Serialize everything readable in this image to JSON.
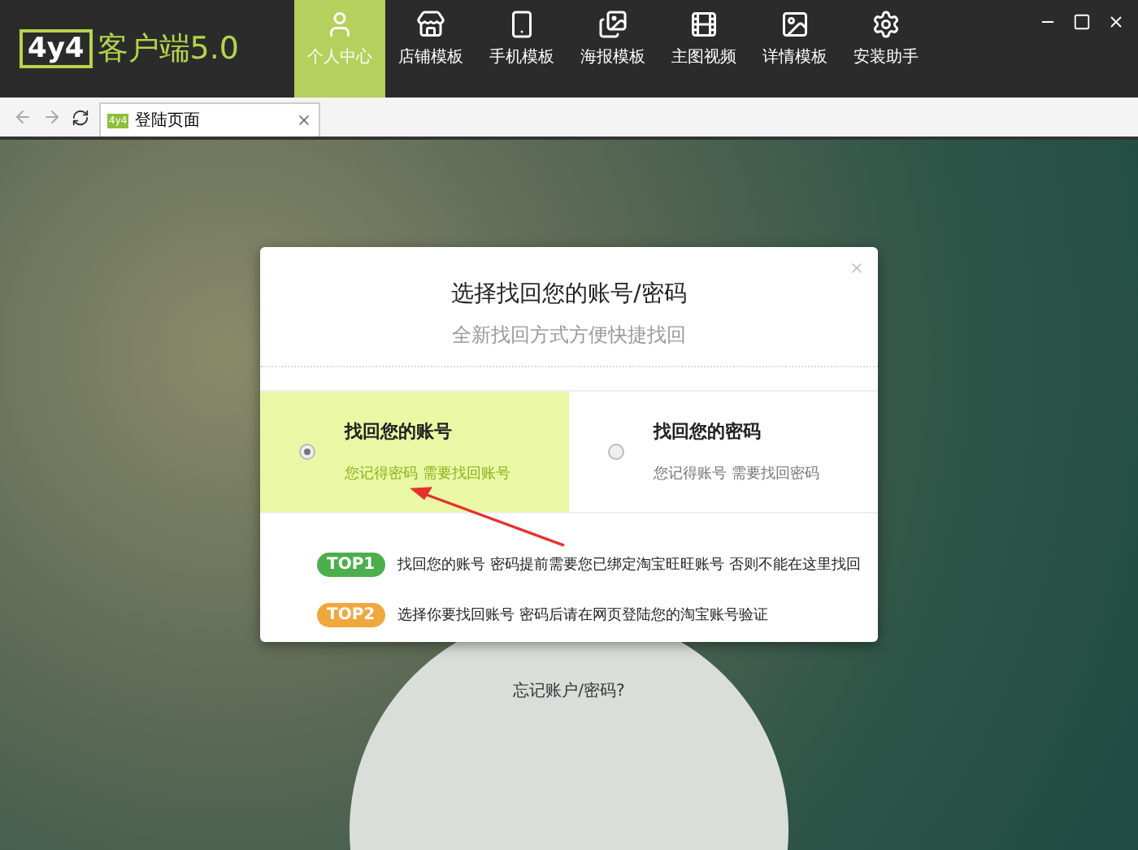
{
  "app": {
    "logo_mark": "4y4",
    "logo_text": "客户端5.0"
  },
  "nav": [
    {
      "label": "个人中心",
      "kind": "user",
      "selected": true
    },
    {
      "label": "店铺模板",
      "kind": "shop",
      "selected": false
    },
    {
      "label": "手机模板",
      "kind": "phone",
      "selected": false
    },
    {
      "label": "海报模板",
      "kind": "poster",
      "selected": false
    },
    {
      "label": "主图视频",
      "kind": "video",
      "selected": false
    },
    {
      "label": "详情模板",
      "kind": "image",
      "selected": false
    },
    {
      "label": "安装助手",
      "kind": "gear",
      "selected": false
    }
  ],
  "browser_tab": {
    "title": "登陆页面",
    "badge": "4y4"
  },
  "login": {
    "forgot_link": "忘记账户/密码?"
  },
  "dialog": {
    "title": "选择找回您的账号/密码",
    "subtitle": "全新找回方式方便快捷找回",
    "options": [
      {
        "title": "找回您的账号",
        "hint": "您记得密码 需要找回账号",
        "selected": true
      },
      {
        "title": "找回您的密码",
        "hint": "您记得账号 需要找回密码",
        "selected": false
      }
    ],
    "tips": [
      {
        "badge": "TOP1",
        "color": "#4cae4c",
        "text": "找回您的账号 密码提前需要您已绑定淘宝旺旺账号 否则不能在这里找回"
      },
      {
        "badge": "TOP2",
        "color": "#f0a73c",
        "text": "选择你要找回账号 密码后请在网页登陆您的淘宝账号验证"
      }
    ]
  }
}
